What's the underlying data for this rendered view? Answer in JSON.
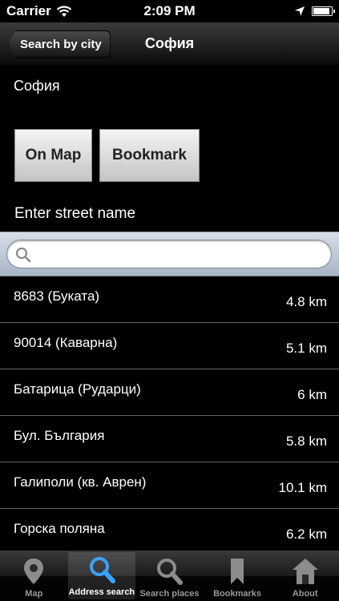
{
  "status_bar": {
    "carrier": "Carrier",
    "time": "2:09 PM"
  },
  "nav": {
    "back_label": "Search by city",
    "title": "София"
  },
  "city_label": "София",
  "buttons": {
    "on_map": "On Map",
    "bookmark": "Bookmark"
  },
  "street_prompt": "Enter street name",
  "search": {
    "placeholder": ""
  },
  "streets": [
    {
      "name": "8683 (Буката)",
      "distance": "4.8 km"
    },
    {
      "name": "90014 (Каварна)",
      "distance": "5.1 km"
    },
    {
      "name": "Батарица (Рударци)",
      "distance": "6 km"
    },
    {
      "name": "Бул. България",
      "distance": "5.8 km"
    },
    {
      "name": "Галиполи (кв. Аврен)",
      "distance": "10.1 km"
    },
    {
      "name": "Горска поляна",
      "distance": "6.2 km"
    }
  ],
  "tabs": [
    {
      "label": "Map",
      "icon": "map-pin-icon"
    },
    {
      "label": "Address search",
      "icon": "search-icon",
      "active": true
    },
    {
      "label": "Search places",
      "icon": "search-icon"
    },
    {
      "label": "Bookmarks",
      "icon": "bookmark-icon"
    },
    {
      "label": "About",
      "icon": "home-icon"
    }
  ]
}
